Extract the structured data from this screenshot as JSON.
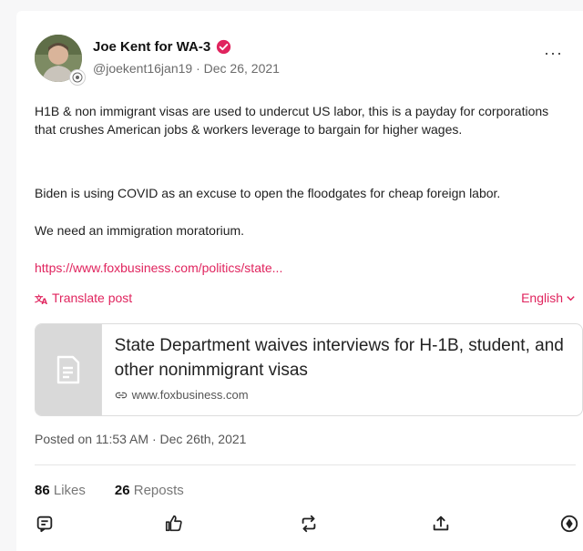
{
  "author": {
    "display_name": "Joe Kent for WA-3",
    "handle": "@joekent16jan19",
    "date": "Dec 26, 2021",
    "separator": " · "
  },
  "post": {
    "paragraphs": [
      "H1B & non immigrant visas are used to undercut US labor, this is a payday for corporations that crushes American jobs & workers leverage to bargain for higher wages.",
      "Biden is using COVID as an excuse to open the floodgates for cheap foreign labor.",
      "We need an immigration moratorium."
    ],
    "link_text": "https://www.foxbusiness.com/politics/state...",
    "translate_label": "Translate post",
    "language_label": "English"
  },
  "link_card": {
    "title": "State Department waives interviews for H-1B, student, and other nonimmigrant visas",
    "domain": "www.foxbusiness.com"
  },
  "posted_on": "Posted on 11:53 AM · Dec 26th, 2021",
  "stats": {
    "likes_count": "86",
    "likes_label": "Likes",
    "reposts_count": "26",
    "reposts_label": "Reposts"
  },
  "more_label": "···",
  "colors": {
    "accent": "#e0245e",
    "verified": "#e0245e"
  },
  "icons": {
    "verified": "verified-badge-icon",
    "translate": "translate-icon",
    "chevron": "chevron-down-icon",
    "document": "document-icon",
    "link": "link-icon",
    "reply": "reply-icon",
    "like": "thumbs-up-icon",
    "repost": "repost-icon",
    "share": "share-icon",
    "tip": "tip-icon"
  }
}
